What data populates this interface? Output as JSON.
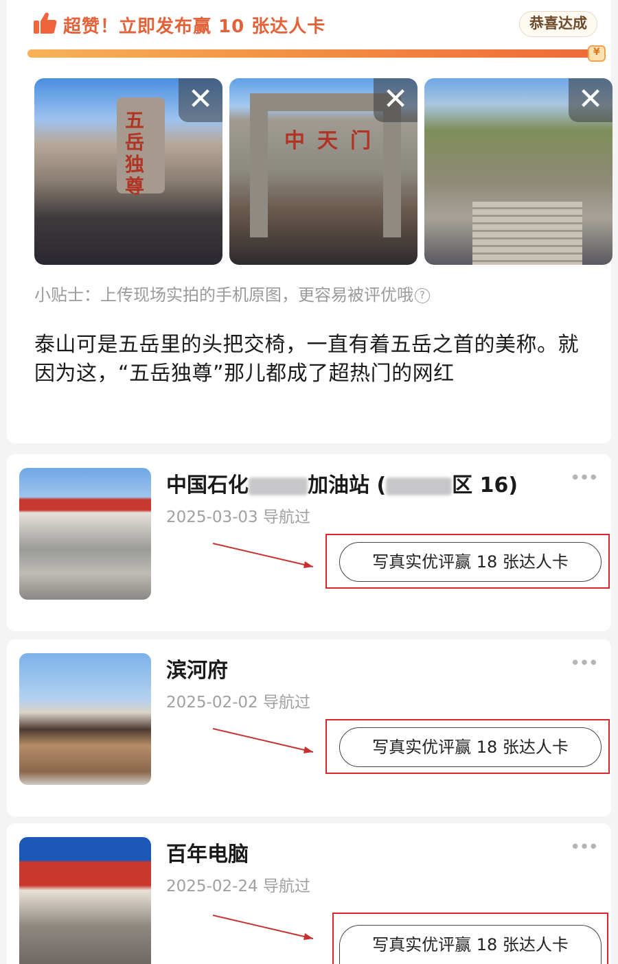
{
  "banner": {
    "text_prefix": "超赞！立即发布赢 ",
    "count": "10",
    "text_suffix": " 张达人卡",
    "achieved_button": "恭喜达成",
    "progress": 1.0
  },
  "photos": [
    {
      "stone_text": "五岳独尊",
      "close": "✕"
    },
    {
      "gate_text": "中天门",
      "close": "✕"
    },
    {
      "close": "✕"
    }
  ],
  "tip": "小贴士：上传现场实拍的手机原图，更容易被评优哦",
  "tip_help_icon": "?",
  "description": "泰山可是五岳里的头把交椅，一直有着五岳之首的美称。就因为这，“五岳独尊”那儿都成了超热门的网红",
  "places": [
    {
      "name_part1": "中国石化",
      "name_part2": "加油站 (",
      "name_part3": "区 16)",
      "date": "2025-03-03 导航过",
      "cta": "写真实优评赢 18 张达人卡",
      "more": "•••"
    },
    {
      "name": "滨河府",
      "date": "2025-02-02 导航过",
      "cta": "写真实优评赢 18 张达人卡",
      "more": "•••"
    },
    {
      "name": "百年电脑",
      "date": "2025-02-24 导航过",
      "cta": "写真实优评赢 18 张达人卡",
      "more": "•••"
    }
  ],
  "colors": {
    "accent": "#e2623a",
    "highlight_box": "#d8262a"
  }
}
